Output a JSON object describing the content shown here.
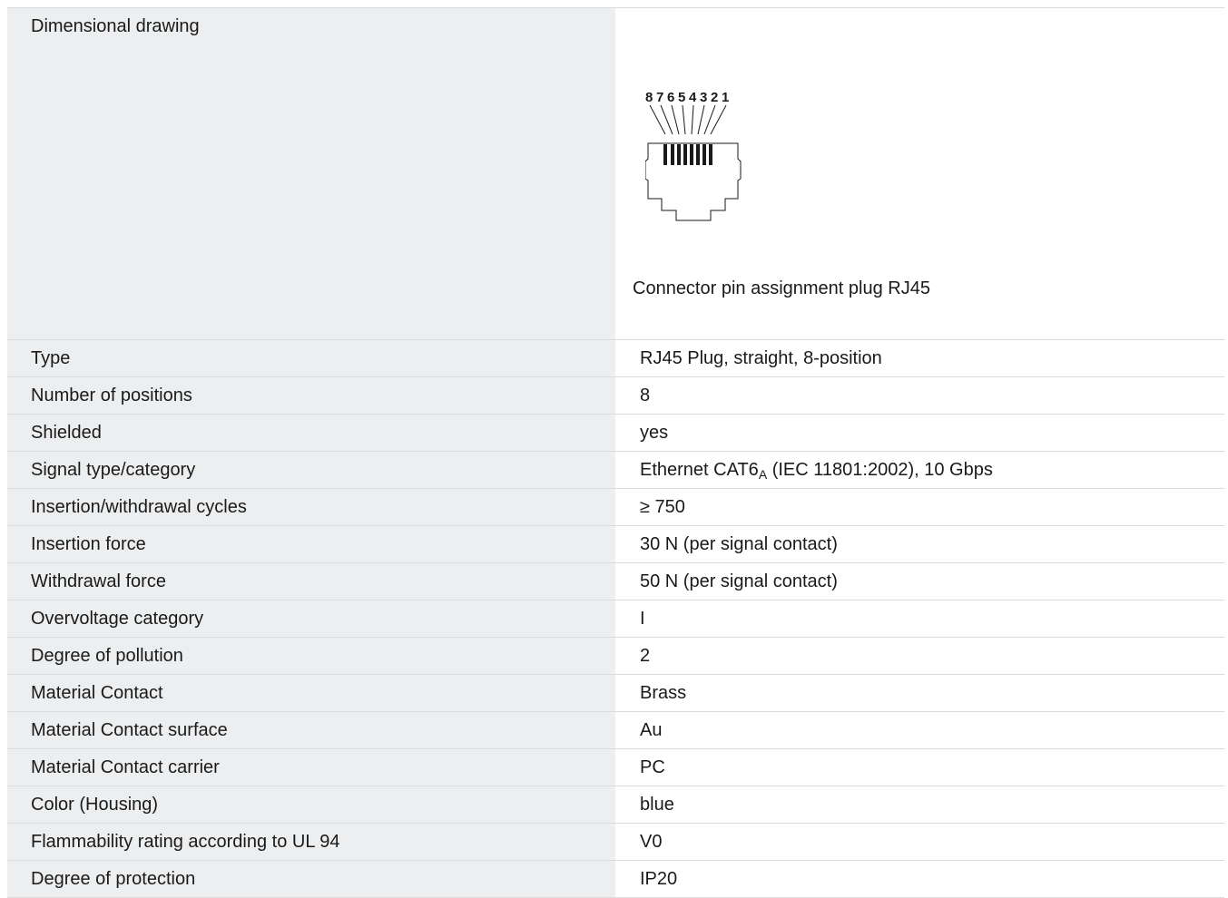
{
  "drawing": {
    "label": "Dimensional drawing",
    "pin_numbers": [
      "8",
      "7",
      "6",
      "5",
      "4",
      "3",
      "2",
      "1"
    ],
    "caption": "Connector pin assignment plug RJ45"
  },
  "specs": [
    {
      "label": "Type",
      "value": "RJ45 Plug, straight, 8-position"
    },
    {
      "label": "Number of positions",
      "value": "8"
    },
    {
      "label": "Shielded",
      "value": "yes"
    },
    {
      "label": "Signal type/category",
      "value_prefix": "Ethernet CAT6",
      "value_sub": "A",
      "value_suffix": " (IEC 11801:2002), 10 Gbps"
    },
    {
      "label": "Insertion/withdrawal cycles",
      "value": "≥ 750"
    },
    {
      "label": "Insertion force",
      "value": "30 N (per signal contact)"
    },
    {
      "label": "Withdrawal force",
      "value": "50 N (per signal contact)"
    },
    {
      "label": "Overvoltage category",
      "value": "I"
    },
    {
      "label": "Degree of pollution",
      "value": "2"
    },
    {
      "label": "Material Contact",
      "value": "Brass"
    },
    {
      "label": "Material Contact surface",
      "value": "Au"
    },
    {
      "label": "Material Contact carrier",
      "value": "PC"
    },
    {
      "label": "Color (Housing)",
      "value": "blue"
    },
    {
      "label": "Flammability rating according to UL 94",
      "value": "V0"
    },
    {
      "label": "Degree of protection",
      "value": "IP20"
    }
  ]
}
